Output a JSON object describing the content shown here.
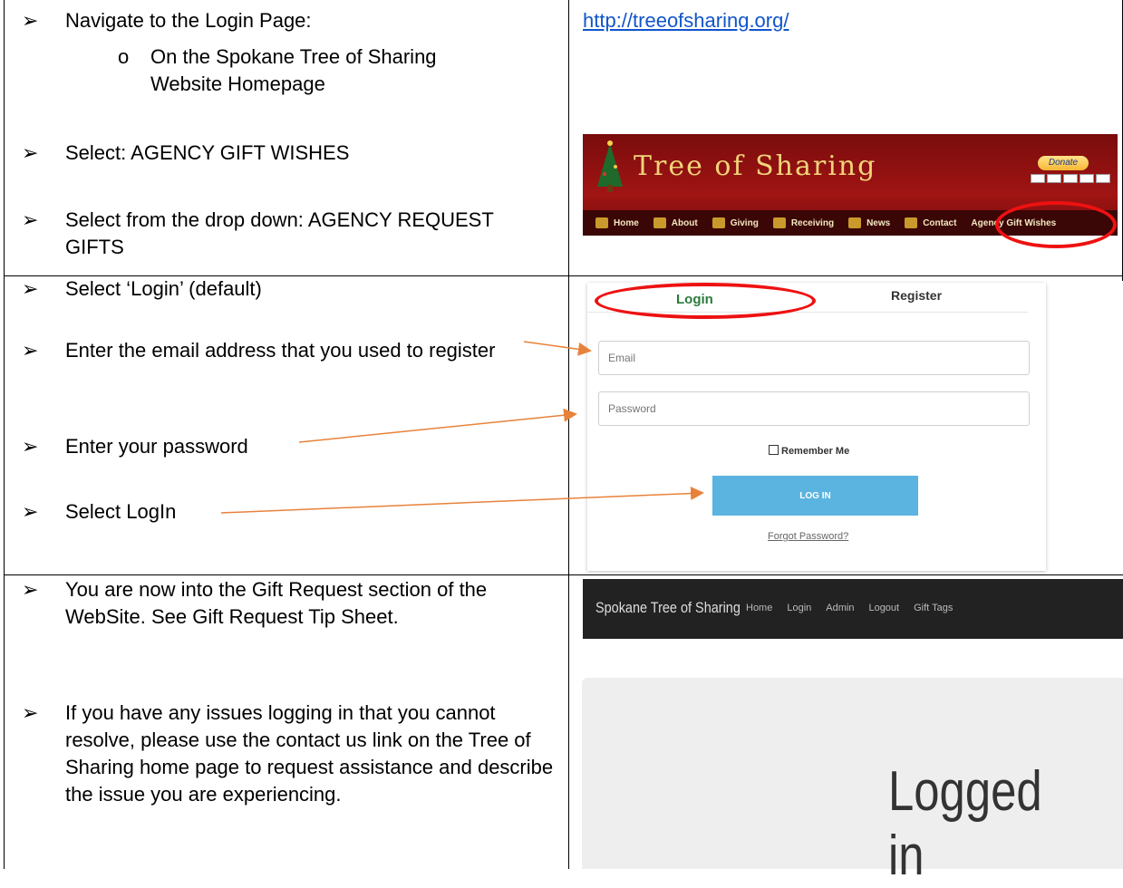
{
  "rows": {
    "row1": {
      "steps": [
        "Navigate to the Login Page:",
        "Select: AGENCY GIFT WISHES",
        "Select from the drop down: AGENCY REQUEST GIFTS"
      ],
      "sub_marker": "o",
      "sub_step": "On the Spokane Tree of Sharing Website Homepage",
      "link": "http://treeofsharing.org/"
    },
    "row2": {
      "steps": [
        "Select ‘Login’ (default)",
        "Enter the email address that you used to register",
        "Enter your password",
        "Select LogIn"
      ]
    },
    "row3": {
      "steps": [
        "You are now into the Gift Request section of the WebSite. See Gift Request Tip Sheet.",
        "If you have any issues logging in that you cannot resolve, please use the contact us link on the Tree of Sharing home page to request assistance and describe the issue you are experiencing."
      ]
    }
  },
  "bullet_glyph": "➢",
  "banner": {
    "title": "Tree of Sharing",
    "donate": "Donate",
    "nav": [
      "Home",
      "About",
      "Giving",
      "Receiving",
      "News",
      "Contact",
      "Agency Gift Wishes"
    ]
  },
  "login_form": {
    "tab_login": "Login",
    "tab_register": "Register",
    "email_placeholder": "Email",
    "password_placeholder": "Password",
    "remember": "Remember Me",
    "button": "LOG IN",
    "forgot": "Forgot Password?"
  },
  "app_bar": {
    "brand": "Spokane Tree of Sharing",
    "nav": [
      "Home",
      "Login",
      "Admin",
      "Logout",
      "Gift Tags"
    ]
  },
  "status_text": "Logged in",
  "colors": {
    "highlight": "#e11111",
    "arrow": "#e8823a",
    "link": "#1155cc",
    "login_button": "#5bb3e0"
  }
}
